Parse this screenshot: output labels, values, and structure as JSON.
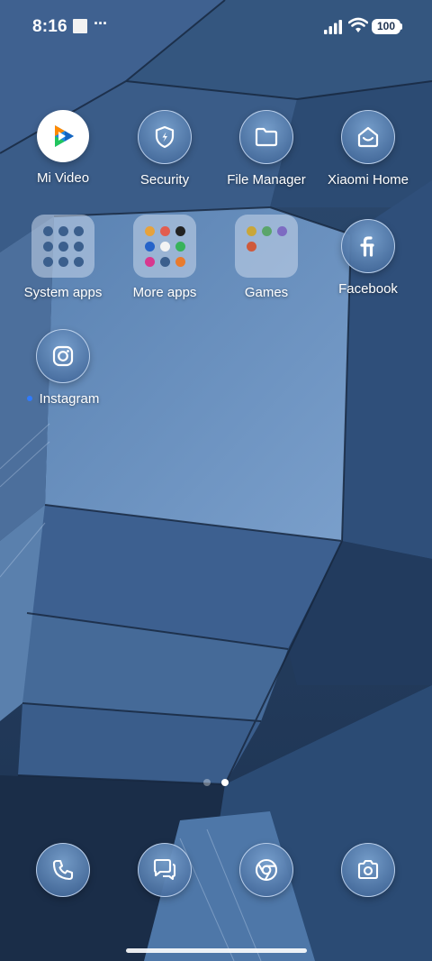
{
  "status_bar": {
    "time": "8:16",
    "more_indicator": "···",
    "battery": "100"
  },
  "home": {
    "row1": [
      {
        "label": "Mi Video",
        "icon": "mi-video-icon"
      },
      {
        "label": "Security",
        "icon": "security-shield-icon"
      },
      {
        "label": "File Manager",
        "icon": "folder-icon"
      },
      {
        "label": "Xiaomi Home",
        "icon": "xiaomi-home-icon"
      }
    ],
    "row2": [
      {
        "label": "System apps",
        "icon": "folder-icon"
      },
      {
        "label": "More apps",
        "icon": "folder-icon"
      },
      {
        "label": "Games",
        "icon": "folder-icon"
      },
      {
        "label": "Facebook",
        "icon": "facebook-icon"
      }
    ],
    "row3": [
      {
        "label": "Instagram",
        "icon": "instagram-icon",
        "new_indicator": true
      }
    ]
  },
  "page_indicator": {
    "pages": 2,
    "current": 2
  },
  "dock": [
    {
      "name": "phone",
      "icon": "phone-icon"
    },
    {
      "name": "messages",
      "icon": "messages-icon"
    },
    {
      "name": "chrome",
      "icon": "chrome-icon"
    },
    {
      "name": "camera",
      "icon": "camera-icon"
    }
  ],
  "colors": {
    "accent_new_dot": "#2f7bff",
    "mi_video_orange": "#ff8a00",
    "mi_video_green": "#22c55e",
    "mi_video_blue": "#1e88e5"
  }
}
